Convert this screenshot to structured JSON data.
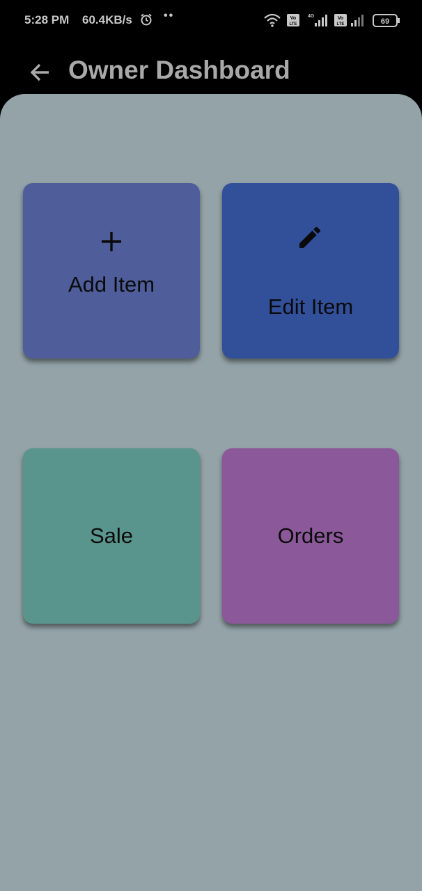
{
  "status_bar": {
    "time": "5:28 PM",
    "network_speed": "60.4KB/s",
    "network_type": "4G",
    "volte_label": "Vo LTE",
    "battery_level": "69",
    "icons": [
      "alarm-icon",
      "wifi-icon",
      "volte-icon",
      "signal-icon",
      "battery-icon"
    ]
  },
  "app_bar": {
    "title": "Owner Dashboard",
    "back_icon": "arrow-left-icon"
  },
  "tiles": [
    {
      "label": "Add Item",
      "icon": "plus-icon",
      "color": "#4f5e9b"
    },
    {
      "label": "Edit Item",
      "icon": "pencil-icon",
      "color": "#324f9a"
    },
    {
      "label": "Sale",
      "icon": "",
      "color": "#5a958d"
    },
    {
      "label": "Orders",
      "icon": "",
      "color": "#8b5999"
    }
  ],
  "colors": {
    "background": "#93a3a7",
    "app_bar": "#000000",
    "title_text": "#a9a9a9"
  }
}
